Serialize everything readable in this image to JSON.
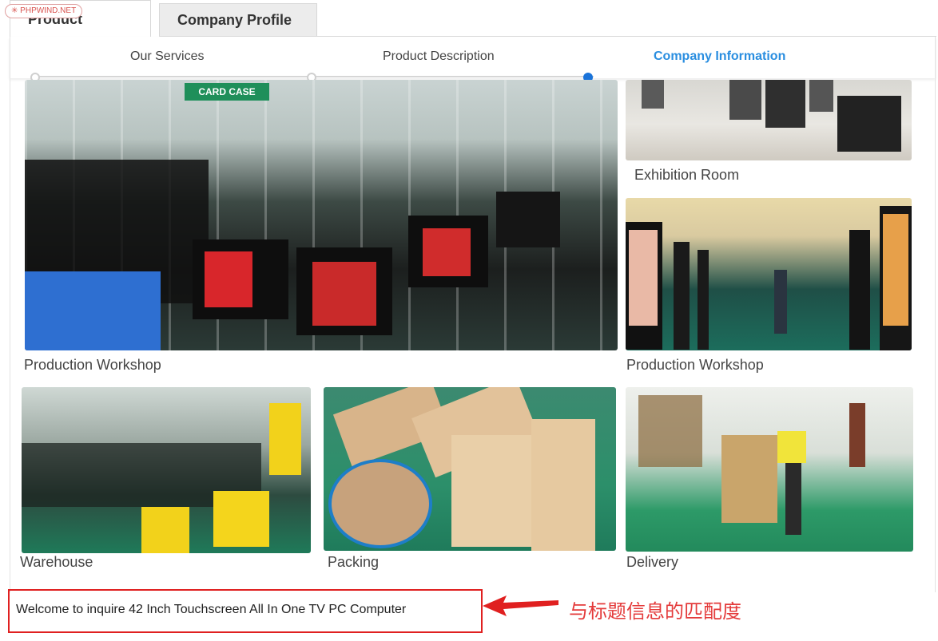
{
  "watermark": "PHPWIND.NET",
  "tabs": [
    {
      "label": "Product Details",
      "active": true
    },
    {
      "label": "Company Profile",
      "active": false
    }
  ],
  "subnav": [
    {
      "label": "Our Services",
      "active": false
    },
    {
      "label": "Product Description",
      "active": false
    },
    {
      "label": "Company Information",
      "active": true
    }
  ],
  "photos": [
    {
      "caption": "Production Workshop",
      "sign": "CARD CASE"
    },
    {
      "caption": "Exhibition  Room"
    },
    {
      "caption": "Production Workshop"
    },
    {
      "caption": "Warehouse"
    },
    {
      "caption": "Packing"
    },
    {
      "caption": "Delivery"
    }
  ],
  "inquiry": "Welcome to inquire 42 Inch Touchscreen All In One TV PC Computer",
  "annotation": "与标题信息的匹配度",
  "colors": {
    "accent": "#2a8ee0",
    "annotation": "#e43b3b",
    "timeline_dot": "#1a73d9"
  }
}
